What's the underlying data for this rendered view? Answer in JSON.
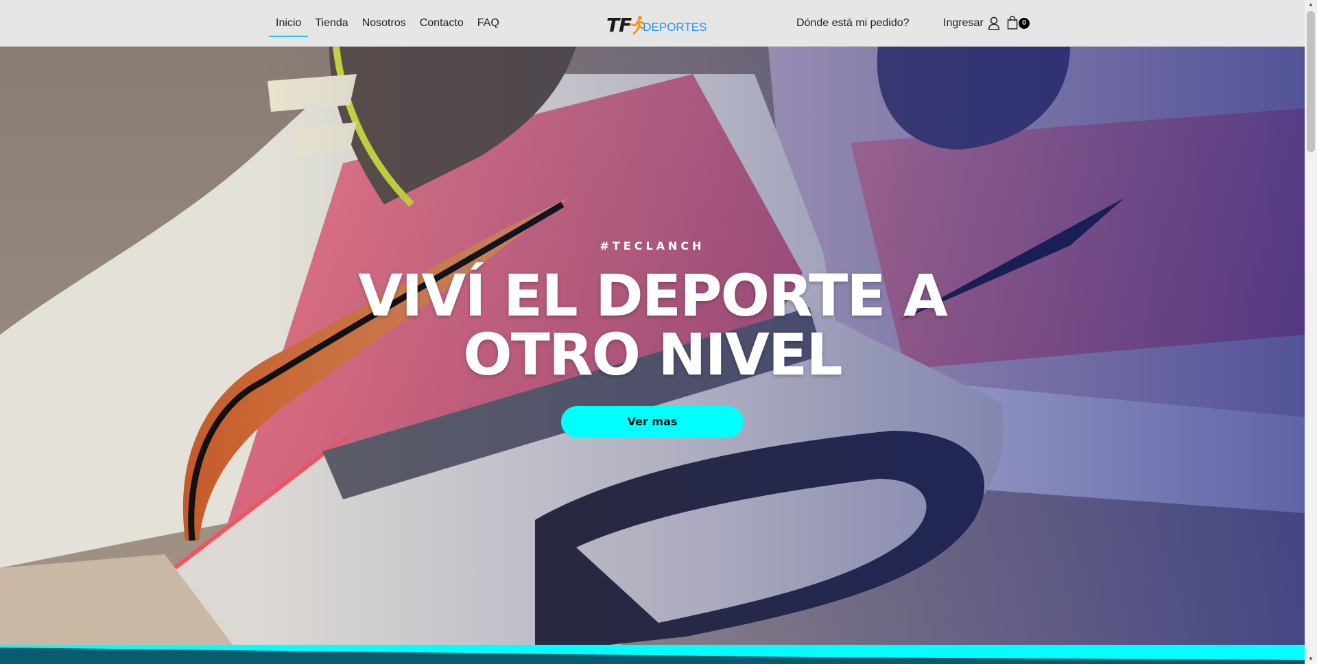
{
  "header": {
    "nav": [
      {
        "label": "Inicio",
        "active": true
      },
      {
        "label": "Tienda",
        "active": false
      },
      {
        "label": "Nosotros",
        "active": false
      },
      {
        "label": "Contacto",
        "active": false
      },
      {
        "label": "FAQ",
        "active": false
      }
    ],
    "logo": {
      "mark": "TF",
      "text": "DEPORTES",
      "icon": "runner-icon"
    },
    "track_order": "Dónde está mi pedido?",
    "login_label": "Ingresar",
    "login_icon": "user-icon",
    "cart_icon": "shopping-bag-icon",
    "cart_count": "0"
  },
  "hero": {
    "tag": "#TECLANCH",
    "title_line1": "VIVÍ EL DEPORTE A",
    "title_line2": "OTRO NIVEL",
    "button_label": "Ver mas"
  },
  "colors": {
    "accent": "#00ffff",
    "nav_underline": "#22c3e6",
    "logo_blue": "#2196f3",
    "logo_orange": "#f7941d",
    "header_bg": "#e6e6e6",
    "band_dark": "#0a5a70"
  }
}
